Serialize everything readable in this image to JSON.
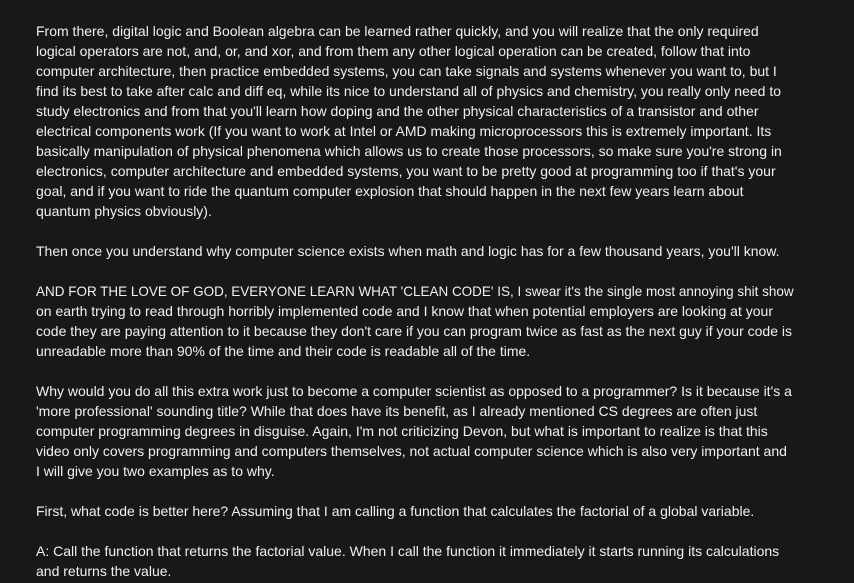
{
  "comment": {
    "paragraphs": [
      {
        "lines": [
          "From there, digital logic and Boolean algebra can be learned rather quickly, and you will realize that the only required",
          "logical operators are not, and, or, and xor, and from them any other logical operation can be created, follow that into",
          "computer architecture, then practice embedded systems, you can take signals and systems whenever you want to, but I",
          "find its best to take after calc and diff eq, while its nice to understand all of physics and chemistry, you really only need to",
          "study electronics and from that you'll learn how doping and the other physical characteristics of a transistor and other",
          "electrical components work (If you want to work at Intel or AMD making microprocessors this is extremely important. Its",
          "basically manipulation of physical phenomena which allows us to create those processors, so make sure you're strong in",
          "electronics, computer architecture and embedded systems, you want to be pretty good at programming too if that's your",
          "goal, and if you want to ride the quantum computer explosion that should happen in the next few years learn about",
          "quantum physics obviously)."
        ]
      },
      {
        "lines": [
          "Then once you understand why computer science exists when math and logic has for a few thousand years, you'll know."
        ]
      },
      {
        "lines": [
          "AND FOR THE LOVE OF GOD, EVERYONE LEARN WHAT 'CLEAN CODE' IS, I swear it's the single most annoying shit show",
          "on earth trying to read through horribly implemented code and I know that when potential employers are looking at your",
          "code they are paying attention to it because they don't care if you can program twice as fast as the next guy if your code is",
          "unreadable more than 90% of the time and their code is readable all of the time."
        ]
      },
      {
        "lines": [
          "Why would you do all this extra work just to become a computer scientist as opposed to a programmer? Is it because it's a",
          "'more professional' sounding title? While that does have its benefit, as I already mentioned CS degrees are often just",
          "computer programming degrees in disguise. Again, I'm not criticizing Devon, but what is important to realize is that this",
          "video only covers programming and computers themselves, not actual computer science which is also very important and",
          "I will give you two examples as to why."
        ]
      },
      {
        "lines": [
          "First, what code is better here? Assuming that I am calling a function that calculates the factorial of a global variable."
        ]
      },
      {
        "lines": [
          "A: Call the function that returns the factorial value. When I call the function it immediately it starts running its calculations",
          "and returns the value."
        ]
      }
    ]
  }
}
